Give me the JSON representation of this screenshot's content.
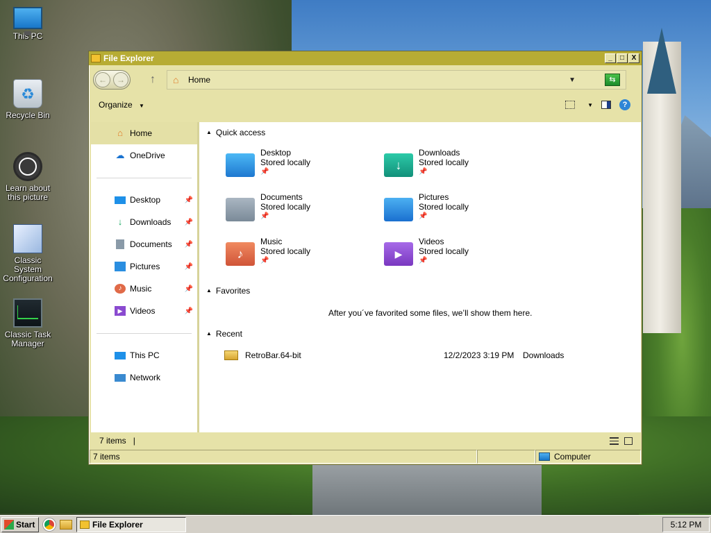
{
  "desktop": {
    "icons": [
      {
        "label": "This PC"
      },
      {
        "label": "Recycle Bin"
      },
      {
        "label": "Learn about this picture"
      },
      {
        "label": "Classic System Configuration"
      },
      {
        "label": "Classic Task Manager"
      }
    ]
  },
  "window": {
    "title": "File Explorer",
    "controls": {
      "minimize": "_",
      "maximize": "□",
      "close": "X"
    },
    "address": {
      "path": "Home"
    },
    "toolbar": {
      "organize": "Organize"
    },
    "nav": {
      "items": [
        {
          "label": "Home",
          "icon": "home-icon",
          "selected": true
        },
        {
          "label": "OneDrive",
          "icon": "cloud-icon"
        },
        {
          "label": "Desktop",
          "icon": "desktop-icon",
          "pinned": true
        },
        {
          "label": "Downloads",
          "icon": "download-icon",
          "pinned": true
        },
        {
          "label": "Documents",
          "icon": "document-icon",
          "pinned": true
        },
        {
          "label": "Pictures",
          "icon": "picture-icon",
          "pinned": true
        },
        {
          "label": "Music",
          "icon": "music-icon",
          "pinned": true
        },
        {
          "label": "Videos",
          "icon": "video-icon",
          "pinned": true
        },
        {
          "label": "This PC",
          "icon": "computer-icon"
        },
        {
          "label": "Network",
          "icon": "network-icon"
        }
      ]
    },
    "content": {
      "quick_access": {
        "header": "Quick access",
        "items": [
          {
            "name": "Desktop",
            "status": "Stored locally",
            "color": "#1e90e8"
          },
          {
            "name": "Downloads",
            "status": "Stored locally",
            "color": "#18a890"
          },
          {
            "name": "Documents",
            "status": "Stored locally",
            "color": "#8a9aa8"
          },
          {
            "name": "Pictures",
            "status": "Stored locally",
            "color": "#2a8ee0"
          },
          {
            "name": "Music",
            "status": "Stored locally",
            "color": "#e06a48"
          },
          {
            "name": "Videos",
            "status": "Stored locally",
            "color": "#8a4ad0"
          }
        ]
      },
      "favorites": {
        "header": "Favorites",
        "empty_message": "After you´ve favorited some files, we’ll show them here."
      },
      "recent": {
        "header": "Recent",
        "items": [
          {
            "name": "RetroBar.64-bit",
            "date": "12/2/2023 3:19 PM",
            "location": "Downloads"
          }
        ]
      }
    },
    "status_inner": {
      "count": "7 items",
      "caret": "|"
    },
    "statusbar": {
      "count": "7 items",
      "zone": "Computer"
    }
  },
  "taskbar": {
    "start_label": "Start",
    "task_label": "File Explorer",
    "clock": "5:12 PM"
  }
}
